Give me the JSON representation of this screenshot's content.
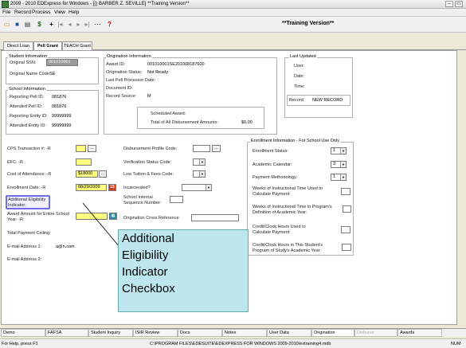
{
  "window": {
    "title": "2009 - 2010 EDExpress for Windows - [() BARBER Z. SEVILLE] **Training Version**",
    "minimize_label": "–",
    "restore_label": "▭"
  },
  "menu": [
    "File",
    "Record",
    "Process",
    "View",
    "Help"
  ],
  "toolbar": {
    "training_label": "**Training Version**",
    "icons": [
      "folder-open-icon",
      "save-icon",
      "print-icon",
      "dollar-icon",
      "plus-icon",
      "first-icon",
      "prev-icon",
      "next-icon",
      "last-icon",
      "ellipsis-icon",
      "help-icon"
    ]
  },
  "tabs": [
    "Direct Loan",
    "Pell Grant",
    "TEACH Grant"
  ],
  "active_tab": "Pell Grant",
  "student_info": {
    "title": "Student Information",
    "original_ssn_label": "Original SSN:",
    "original_ssn": "001010001",
    "original_name_code_label": "Original Name Code:",
    "original_name_code": "SE"
  },
  "school_info": {
    "title": "School Information",
    "reporting_pell_label": "Reporting Pell ID:",
    "reporting_pell": "081876",
    "attended_pell_label": "Attended Pell ID:",
    "attended_pell": "081876",
    "reporting_entity_label": "Reporting Entity ID:",
    "reporting_entity": "99999999",
    "attended_entity_label": "Attended Entity ID:",
    "attended_entity": "99999999"
  },
  "origination_info": {
    "title": "Origination Information",
    "award_id_label": "Award ID:",
    "award_id": "001010001SE20100818760​0",
    "status_label": "Origination Status:",
    "status": "Not Ready",
    "last_pell_label": "Last Pell Processor Date:",
    "document_id_label": "Document ID:",
    "record_source_label": "Record Source:",
    "record_source": "M",
    "scheduled_award_label": "Scheduled Award:",
    "total_disb_label": "Total of All Disbursement Amounts:",
    "total_disb": "$0.00"
  },
  "last_updated": {
    "title": "Last Updated",
    "user_label": "User:",
    "date_label": "Date:",
    "time_label": "Time:",
    "record_label": "Record:",
    "record": "NEW RECORD"
  },
  "left_fields": {
    "cps_label": "CPS Transaction #: -R",
    "efc_label": "EFC: -R",
    "coa_label": "Cost of Attendance: -R",
    "coa_value": "$18000",
    "enrollment_label": "Enrollment Date: -R",
    "enrollment_value": "08/29/2009",
    "calendar_label": "15",
    "additional_elig_label": "Additional Eligibility Indicator:",
    "award_amount_label": "Award Amount for Entire School Year: -R",
    "total_payment_label": "Total Payment Ceiling:",
    "email1_label": "E-mail Address 1:",
    "email1_value": "a@n.com",
    "email2_label": "E-mail Address 2:",
    "ellipsis": "..."
  },
  "middle_fields": {
    "disb_profile_label": "Disbursement Profile Code:",
    "verification_label": "Verification Status Code:",
    "low_tuition_label": "Low Tuition & Fees Code:",
    "incarcerated_label": "Incarcerated?",
    "school_internal_label": "School Internal Sequence Number:",
    "orig_cross_ref_label": "Origination Cross Reference:"
  },
  "enrollment_info": {
    "title": "Enrollment Information - For School Use Only",
    "enrollment_status_label": "Enrollment Status:",
    "enrollment_status": "1",
    "academic_calendar_label": "Academic Calendar:",
    "academic_calendar": "3",
    "payment_method_label": "Payment Methodology:",
    "payment_method": "1",
    "weeks_calc_label": "Weeks of Instructional Time Used to Calculate Payment:",
    "weeks_program_label": "Weeks of Instructional Time in Program's Definition of Academic Year:",
    "credit_used_label": "Credit/Clock Hours Used to Calculate Payment:",
    "credit_program_label": "Credit/Clock Hours in This Student's Program of Study's Academic Year:"
  },
  "callout": {
    "lines": [
      "Additional",
      "Eligibility",
      "Indicator",
      "Checkbox"
    ]
  },
  "bottom_tabs": [
    "Demo",
    "FAFSA",
    "Student Inquiry",
    "ISIR Review",
    "Docs",
    "Notes",
    "User Data",
    "Origination",
    "Disburse",
    "Awards"
  ],
  "active_bottom_tab": "Origination",
  "status": {
    "help": "For Help, press F1",
    "path": "C:\\PROGRAM FILES\\EDESUITE\\EDEXPRESS FOR WINDOWS 2009-2010\\extraining4.mdb",
    "num": "NUM"
  },
  "colors": {
    "required_field": "#ffff80",
    "highlight_border": "#6d6de6",
    "callout_bg": "#bde6ee"
  }
}
